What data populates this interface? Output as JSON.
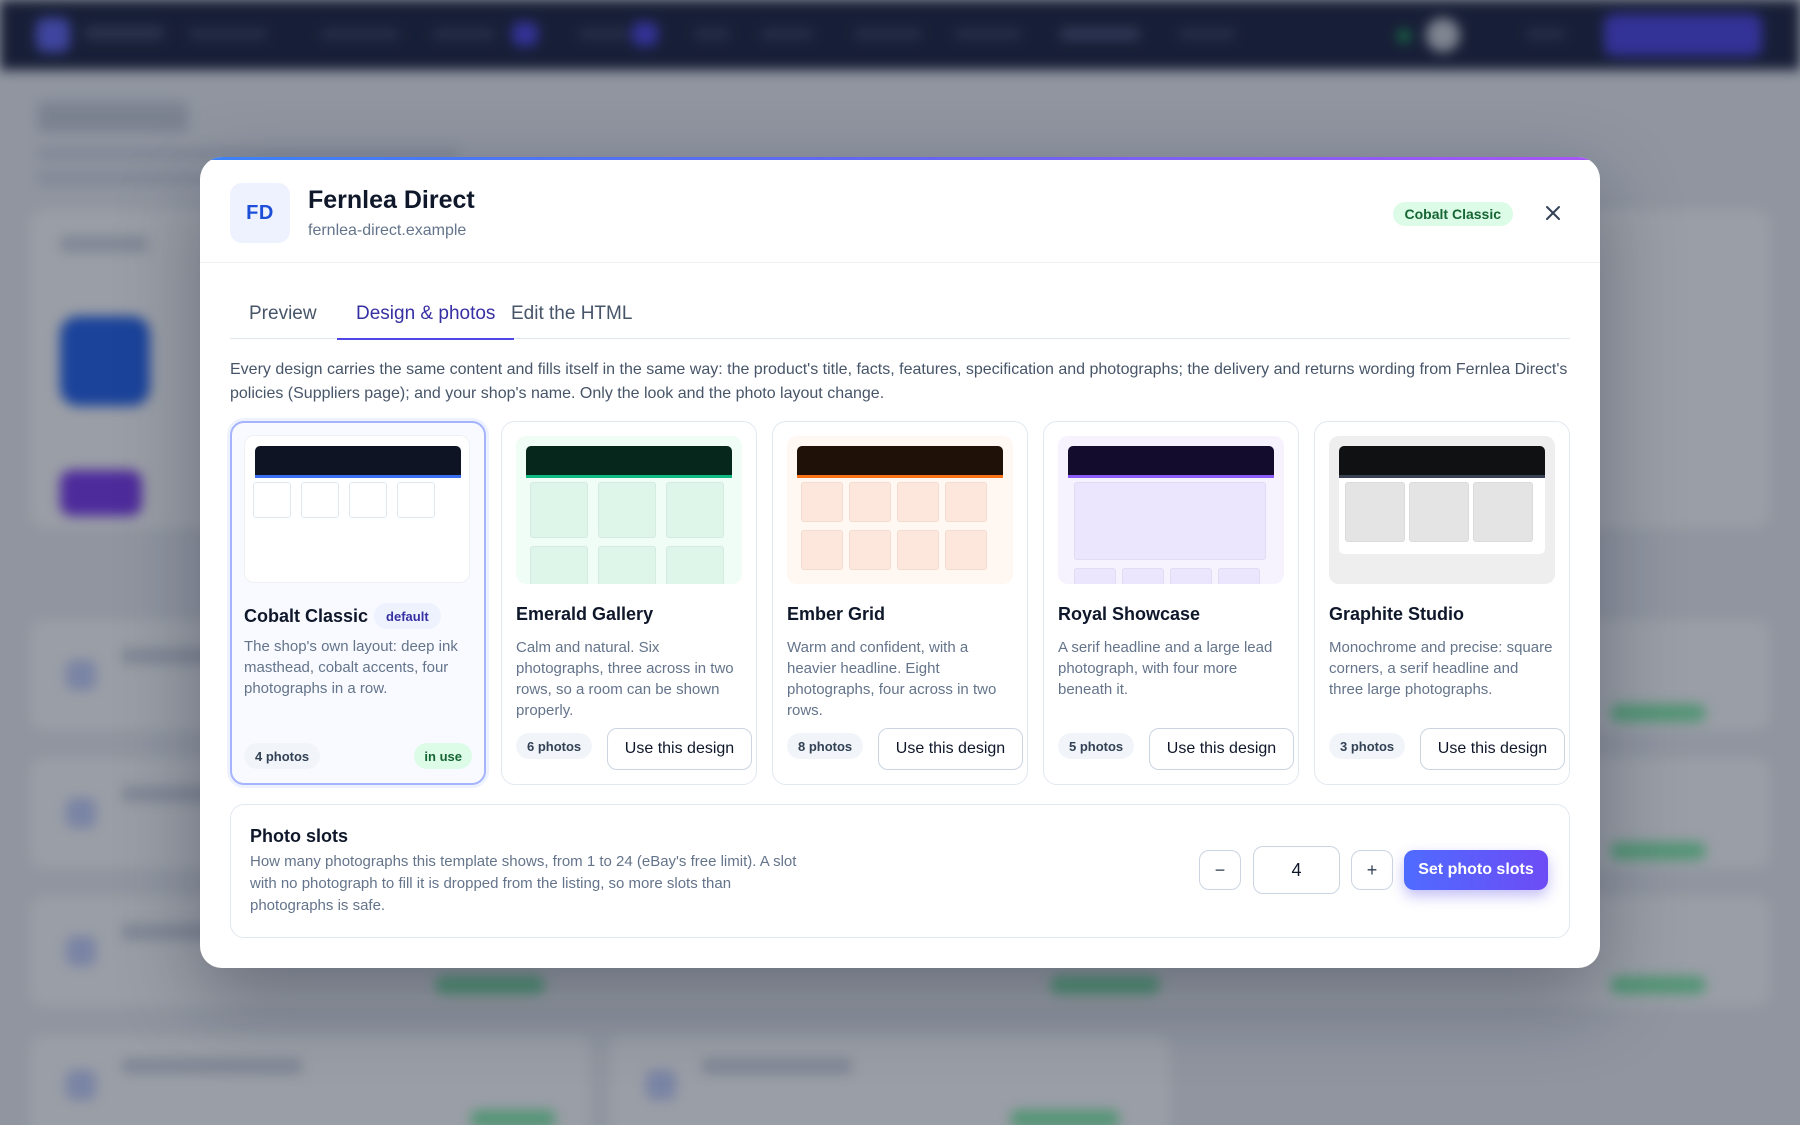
{
  "modal": {
    "avatar_initials": "FD",
    "shop_name": "Fernlea Direct",
    "shop_domain": "fernlea-direct.example",
    "current_template_badge": "Cobalt Classic",
    "close_icon": "close-icon"
  },
  "tabs": [
    {
      "label": "Preview",
      "active": false
    },
    {
      "label": "Design & photos",
      "active": true
    },
    {
      "label": "Edit the HTML",
      "active": false
    }
  ],
  "intro_text": "Every design carries the same content and fills itself in the same way: the product's title, facts, features, specification and photographs; the delivery and returns wording from Fernlea Direct's policies (Suppliers page); and your shop's name. Only the look and the photo layout change.",
  "designs": [
    {
      "name": "Cobalt Classic",
      "badge": "default",
      "description": "The shop's own layout: deep ink masthead, cobalt accents, four photographs in a row.",
      "photos": "4 photos",
      "status": "in use",
      "selected": true,
      "colors": {
        "masthead": "#0f1424",
        "accent": "#3b6ff2",
        "bg": "#ffffff",
        "cell": "#ffffff"
      }
    },
    {
      "name": "Emerald Gallery",
      "description": "Calm and natural. Six photographs, three across in two rows, so a room can be shown properly.",
      "photos": "6 photos",
      "action": "Use this design",
      "colors": {
        "masthead": "#06281c",
        "accent": "#10b981",
        "bg": "#f0fdf6",
        "cell": "#def5ea"
      }
    },
    {
      "name": "Ember Grid",
      "description": "Warm and confident, with a heavier headline. Eight photographs, four across in two rows.",
      "photos": "8 photos",
      "action": "Use this design",
      "colors": {
        "masthead": "#1f1108",
        "accent": "#f97316",
        "bg": "#fff7f2",
        "cell": "#fde6db"
      }
    },
    {
      "name": "Royal Showcase",
      "description": "A serif headline and a large lead photograph, with four more beneath it.",
      "photos": "5 photos",
      "action": "Use this design",
      "colors": {
        "masthead": "#140c2c",
        "accent": "#8b5cf6",
        "bg": "#f6f3ff",
        "cell": "#ebe5fd"
      }
    },
    {
      "name": "Graphite Studio",
      "description": "Monochrome and precise: square corners, a serif headline and three large photographs.",
      "photos": "3 photos",
      "action": "Use this design",
      "colors": {
        "masthead": "#101113",
        "accent": "#374151",
        "bg": "#eeeeee",
        "cell": "#e4e4e4"
      }
    }
  ],
  "photo_slots": {
    "title": "Photo slots",
    "description": "How many photographs this template shows, from 1 to 24 (eBay's free limit). A slot with no photograph to fill it is dropped from the listing, so more slots than photographs is safe.",
    "decrement_label": "−",
    "value": "4",
    "increment_label": "+",
    "submit_label": "Set photo slots"
  }
}
